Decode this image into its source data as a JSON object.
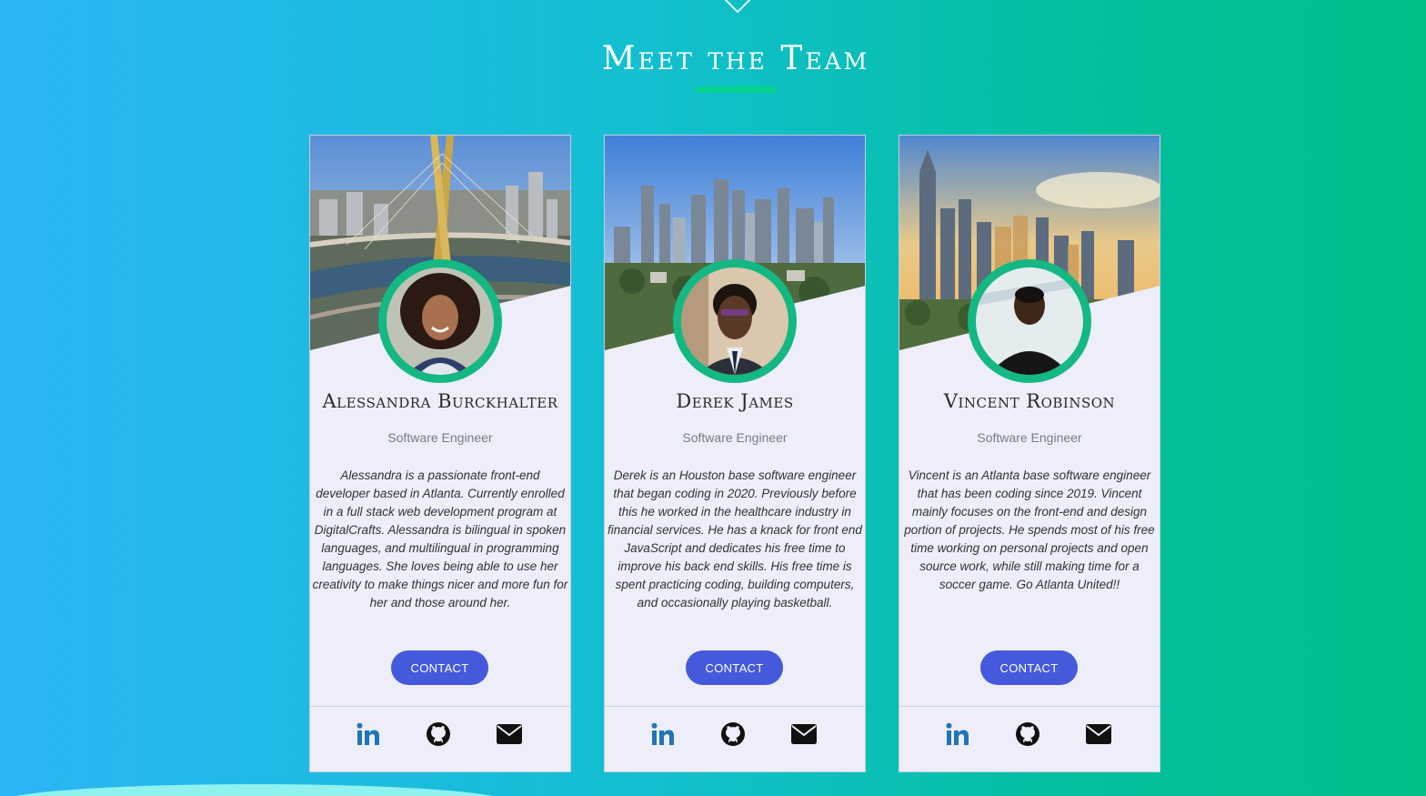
{
  "section": {
    "title": "Meet the Team"
  },
  "colors": {
    "accent": "#07d28f",
    "button": "#4459dc",
    "linkedin": "#1f75b8",
    "ring": "#13b882"
  },
  "icons": [
    "chevron-down-icon",
    "linkedin-icon",
    "github-icon",
    "email-icon"
  ],
  "team": [
    {
      "name": "Alessandra Burckhalter",
      "role": "Software Engineer",
      "bio": "Alessandra is a passionate front-end developer based in Atlanta. Currently enrolled in a full stack web development program at DigitalCrafts. Alessandra is bilingual in spoken languages, and multilingual in programming languages. She loves being able to use her creativity to make things nicer and more fun for her and those around her.",
      "contact_label": "CONTACT"
    },
    {
      "name": "Derek James",
      "role": "Software Engineer",
      "bio": "Derek is an Houston base software engineer that began coding in 2020. Previously before this he worked in the healthcare industry in financial services. He has a knack for front end JavaScript and dedicates his free time to improve his back end skills. His free time is spent practicing coding, building computers, and occasionally playing basketball.",
      "contact_label": "CONTACT"
    },
    {
      "name": "Vincent Robinson",
      "role": "Software Engineer",
      "bio": "Vincent is an Atlanta base software engineer that has been coding since 2019. Vincent mainly focuses on the front-end and design portion of projects. He spends most of his free time working on personal projects and open source work, while still making time for a soccer game. Go Atlanta United!!",
      "contact_label": "CONTACT"
    }
  ]
}
